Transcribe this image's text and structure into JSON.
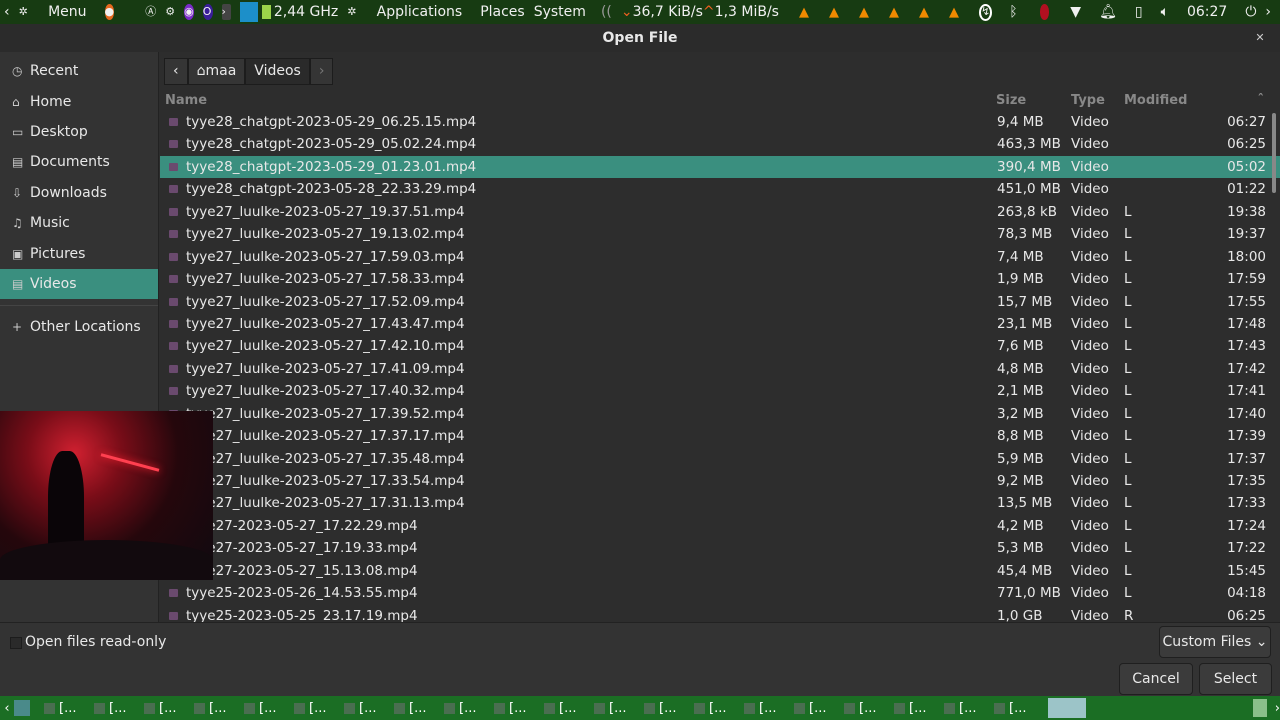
{
  "panel": {
    "menu": "Menu",
    "cpu": "2,44 GHz",
    "applications": "Applications",
    "places": "Places",
    "system": "System",
    "net_down": "36,7 KiB/s",
    "net_up": "1,3 MiB/s",
    "clock": "06:27",
    "vlc_count": 6
  },
  "dialog": {
    "title": "Open File"
  },
  "sidebar": {
    "items": [
      {
        "label": "Recent",
        "icon": "clock-icon"
      },
      {
        "label": "Home",
        "icon": "home-icon"
      },
      {
        "label": "Desktop",
        "icon": "desktop-icon"
      },
      {
        "label": "Documents",
        "icon": "document-icon"
      },
      {
        "label": "Downloads",
        "icon": "download-icon"
      },
      {
        "label": "Music",
        "icon": "music-icon"
      },
      {
        "label": "Pictures",
        "icon": "pictures-icon"
      },
      {
        "label": "Videos",
        "icon": "video-icon"
      }
    ],
    "other": "Other Locations"
  },
  "path": {
    "home": "maa",
    "current": "Videos"
  },
  "columns": {
    "name": "Name",
    "size": "Size",
    "type": "Type",
    "modified": "Modified"
  },
  "files": [
    {
      "name": "tyye28_chatgpt-2023-05-29_06.25.15.mp4",
      "size": "9,4 MB",
      "type": "Video",
      "mod": "",
      "time": "06:27"
    },
    {
      "name": "tyye28_chatgpt-2023-05-29_05.02.24.mp4",
      "size": "463,3 MB",
      "type": "Video",
      "mod": "",
      "time": "06:25"
    },
    {
      "name": "tyye28_chatgpt-2023-05-29_01.23.01.mp4",
      "size": "390,4 MB",
      "type": "Video",
      "mod": "",
      "time": "05:02",
      "selected": true
    },
    {
      "name": "tyye28_chatgpt-2023-05-28_22.33.29.mp4",
      "size": "451,0 MB",
      "type": "Video",
      "mod": "",
      "time": "01:22"
    },
    {
      "name": "tyye27_luulke-2023-05-27_19.37.51.mp4",
      "size": "263,8 kB",
      "type": "Video",
      "mod": "L",
      "time": "19:38"
    },
    {
      "name": "tyye27_luulke-2023-05-27_19.13.02.mp4",
      "size": "78,3 MB",
      "type": "Video",
      "mod": "L",
      "time": "19:37"
    },
    {
      "name": "tyye27_luulke-2023-05-27_17.59.03.mp4",
      "size": "7,4 MB",
      "type": "Video",
      "mod": "L",
      "time": "18:00"
    },
    {
      "name": "tyye27_luulke-2023-05-27_17.58.33.mp4",
      "size": "1,9 MB",
      "type": "Video",
      "mod": "L",
      "time": "17:59"
    },
    {
      "name": "tyye27_luulke-2023-05-27_17.52.09.mp4",
      "size": "15,7 MB",
      "type": "Video",
      "mod": "L",
      "time": "17:55"
    },
    {
      "name": "tyye27_luulke-2023-05-27_17.43.47.mp4",
      "size": "23,1 MB",
      "type": "Video",
      "mod": "L",
      "time": "17:48"
    },
    {
      "name": "tyye27_luulke-2023-05-27_17.42.10.mp4",
      "size": "7,6 MB",
      "type": "Video",
      "mod": "L",
      "time": "17:43"
    },
    {
      "name": "tyye27_luulke-2023-05-27_17.41.09.mp4",
      "size": "4,8 MB",
      "type": "Video",
      "mod": "L",
      "time": "17:42"
    },
    {
      "name": "tyye27_luulke-2023-05-27_17.40.32.mp4",
      "size": "2,1 MB",
      "type": "Video",
      "mod": "L",
      "time": "17:41"
    },
    {
      "name": "tyye27_luulke-2023-05-27_17.39.52.mp4",
      "size": "3,2 MB",
      "type": "Video",
      "mod": "L",
      "time": "17:40"
    },
    {
      "name": "tyye27_luulke-2023-05-27_17.37.17.mp4",
      "size": "8,8 MB",
      "type": "Video",
      "mod": "L",
      "time": "17:39"
    },
    {
      "name": "tyye27_luulke-2023-05-27_17.35.48.mp4",
      "size": "5,9 MB",
      "type": "Video",
      "mod": "L",
      "time": "17:37"
    },
    {
      "name": "tyye27_luulke-2023-05-27_17.33.54.mp4",
      "size": "9,2 MB",
      "type": "Video",
      "mod": "L",
      "time": "17:35"
    },
    {
      "name": "tyye27_luulke-2023-05-27_17.31.13.mp4",
      "size": "13,5 MB",
      "type": "Video",
      "mod": "L",
      "time": "17:33"
    },
    {
      "name": "tyye27-2023-05-27_17.22.29.mp4",
      "size": "4,2 MB",
      "type": "Video",
      "mod": "L",
      "time": "17:24"
    },
    {
      "name": "tyye27-2023-05-27_17.19.33.mp4",
      "size": "5,3 MB",
      "type": "Video",
      "mod": "L",
      "time": "17:22"
    },
    {
      "name": "tyye27-2023-05-27_15.13.08.mp4",
      "size": "45,4 MB",
      "type": "Video",
      "mod": "L",
      "time": "15:45"
    },
    {
      "name": "tyye25-2023-05-26_14.53.55.mp4",
      "size": "771,0 MB",
      "type": "Video",
      "mod": "L",
      "time": "04:18"
    },
    {
      "name": "tyye25-2023-05-25_23.17.19.mp4",
      "size": "1,0 GB",
      "type": "Video",
      "mod": "R",
      "time": "06:25"
    }
  ],
  "bottom": {
    "readonly": "Open files read-only",
    "filter": "Custom Files",
    "cancel": "Cancel",
    "select": "Select"
  },
  "taskbar": {
    "item_label": "[...",
    "count": 20
  },
  "colors": {
    "selection": "#3a8f7f",
    "panel": "#173b12",
    "taskbar": "#1b6e24"
  }
}
